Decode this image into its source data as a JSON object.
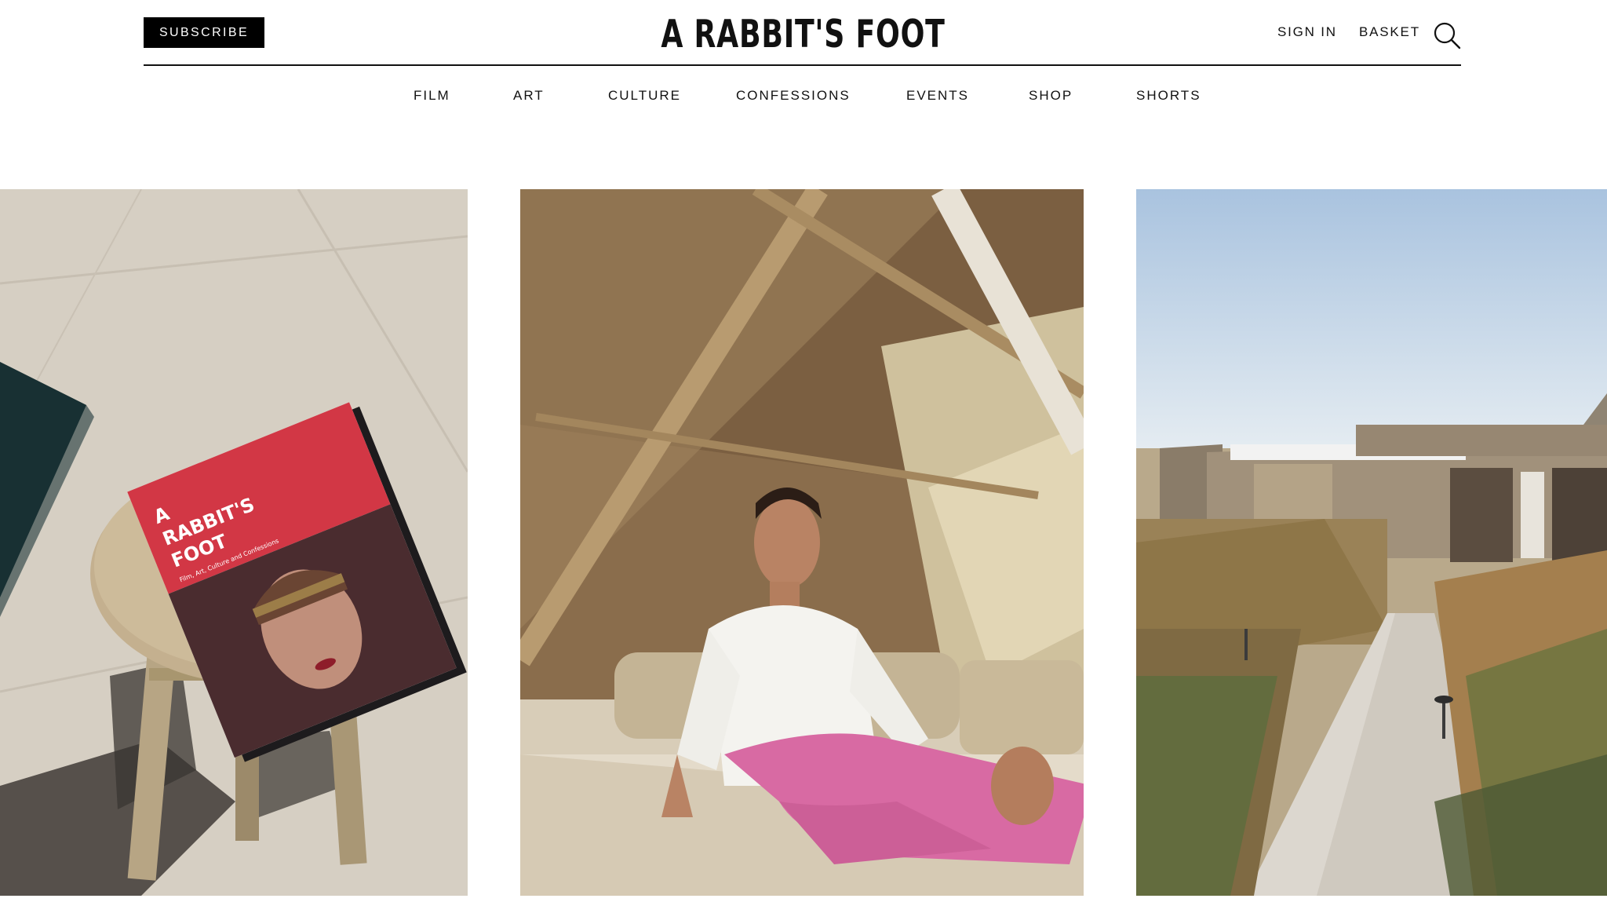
{
  "header": {
    "subscribe_label": "SUBSCRIBE",
    "logo_text": "A RABBIT'S FOOT",
    "sign_in_label": "SIGN IN",
    "basket_label": "BASKET",
    "search_icon": "search-icon"
  },
  "nav": {
    "items": [
      "FILM",
      "ART",
      "CULTURE",
      "CONFESSIONS",
      "EVENTS",
      "SHOP",
      "SHORTS"
    ]
  },
  "gallery": {
    "magazine_cover": {
      "title_line1": "A",
      "title_line2": "RABBIT'S",
      "title_line3": "FOOT",
      "subtitle": "Film, Art, Culture and Confessions"
    }
  },
  "colors": {
    "magazine_red": "#d23745",
    "skirt_pink": "#d86aa3",
    "sky_blue": "#a9c3df",
    "stone_paving": "#d8d1c6"
  }
}
